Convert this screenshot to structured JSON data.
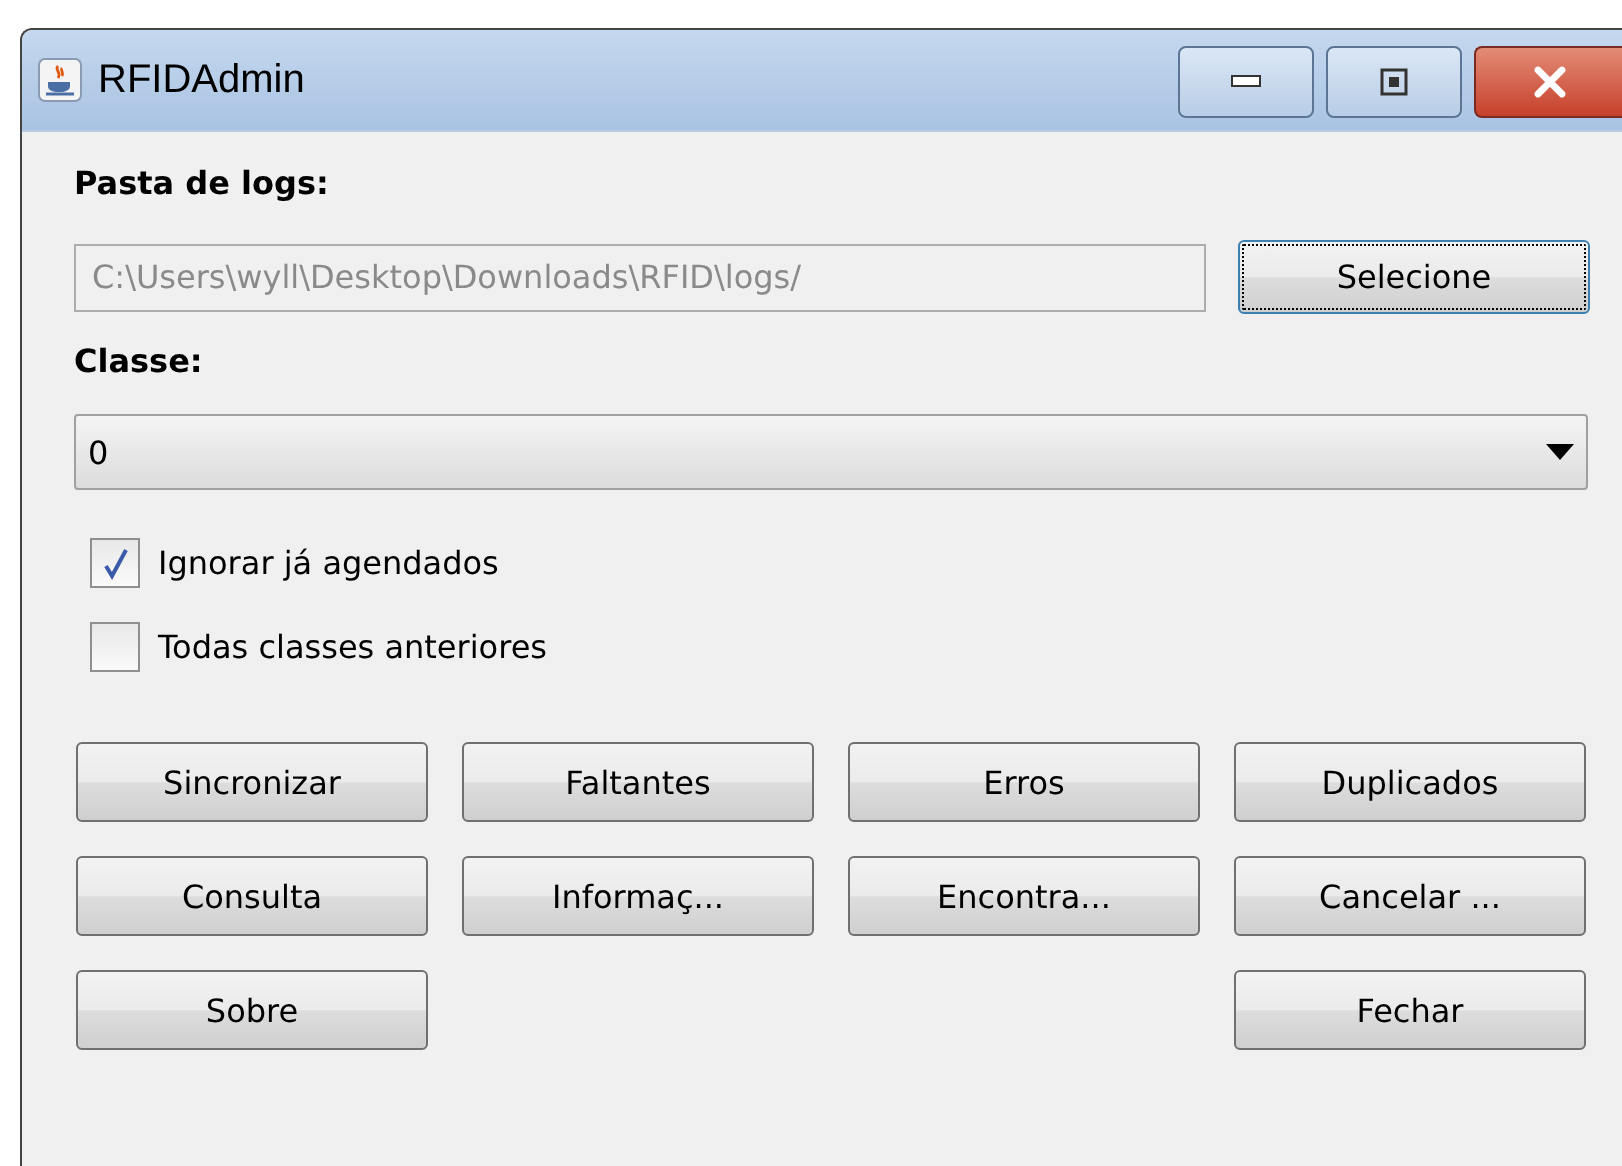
{
  "window": {
    "title": "RFIDAdmin"
  },
  "folder": {
    "label": "Pasta de logs:",
    "value": "C:\\Users\\wyll\\Desktop\\Downloads\\RFID\\logs/",
    "disabled": true,
    "button": {
      "label": "Selecione",
      "focused": true
    }
  },
  "classe": {
    "label": "Classe:",
    "value": "0"
  },
  "options": [
    {
      "label": "Ignorar já agendados",
      "checked": true
    },
    {
      "label": "Todas classes anteriores",
      "checked": false
    }
  ],
  "button_rows": [
    [
      "Sincronizar",
      "Faltantes",
      "Erros",
      "Duplicados"
    ],
    [
      "Consulta",
      "Informaç...",
      "Encontra...",
      "Cancelar ..."
    ]
  ],
  "bottom_left": "Sobre",
  "bottom_right": "Fechar"
}
